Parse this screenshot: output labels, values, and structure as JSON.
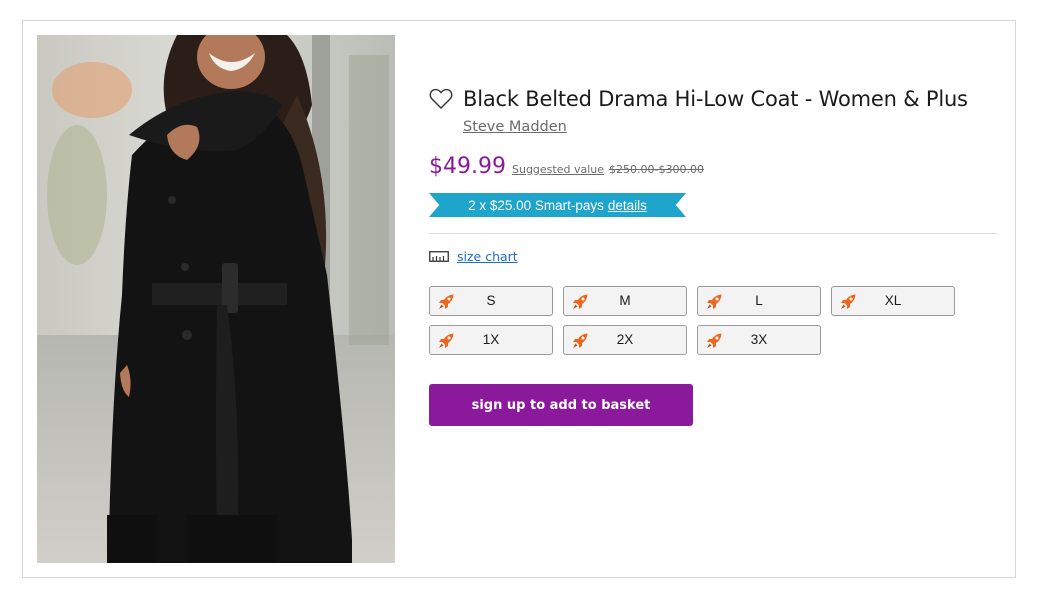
{
  "product": {
    "title": "Black Belted Drama Hi-Low Coat - Women & Plus",
    "brand": "Steve Madden",
    "price": "$49.99",
    "suggested_label": "Suggested value",
    "suggested_range": "$250.00-$300.00",
    "smartpays_text": "2 x $25.00 Smart-pays",
    "smartpays_link": "details",
    "size_chart_label": "size chart",
    "sizes": [
      "S",
      "M",
      "L",
      "XL",
      "1X",
      "2X",
      "3X"
    ],
    "cta_label": "sign up to add to basket"
  },
  "colors": {
    "accent_purple": "#8a1a9b",
    "banner_blue": "#1fa4cc",
    "link_blue": "#1a6fc7",
    "rocket_orange": "#f0651e"
  },
  "icons": [
    "heart-icon",
    "ruler-icon",
    "rocket-icon"
  ]
}
